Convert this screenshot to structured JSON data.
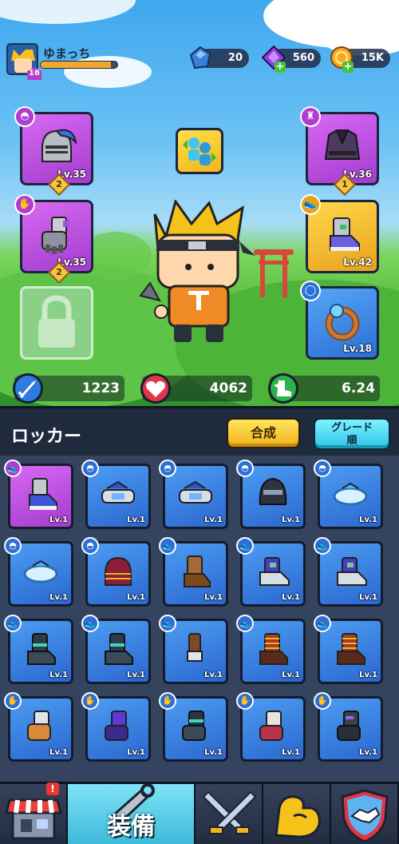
{
  "player": {
    "name": "ゆまっち",
    "level": "16",
    "xp_fraction": 0.92
  },
  "currencies": {
    "crystal": "20",
    "gem": "560",
    "coin": "15K"
  },
  "equipment": {
    "head": {
      "level": "Lv.35",
      "rank": "2"
    },
    "hands": {
      "level": "Lv.35",
      "rank": "2"
    },
    "body": {
      "level": "Lv.36",
      "rank": "1"
    },
    "feet": {
      "level": "Lv.42"
    },
    "ring": {
      "level": "Lv.18"
    }
  },
  "stats": {
    "attack": "1223",
    "health": "4062",
    "speed": "6.24"
  },
  "locker": {
    "title": "ロッカー",
    "merge_label": "合成",
    "sort_label_line1": "グレード",
    "sort_label_line2": "順",
    "items": [
      {
        "type": "shoe",
        "rarity": "purple",
        "art": "sneaker-gray",
        "level": "Lv.1"
      },
      {
        "type": "helmet",
        "rarity": "blue",
        "art": "headband-blue",
        "level": "Lv.1"
      },
      {
        "type": "helmet",
        "rarity": "blue",
        "art": "headband-blue",
        "level": "Lv.1"
      },
      {
        "type": "helmet",
        "rarity": "blue",
        "art": "ninja-hood",
        "level": "Lv.1"
      },
      {
        "type": "helmet",
        "rarity": "blue",
        "art": "headband-cyan",
        "level": "Lv.1"
      },
      {
        "type": "helmet",
        "rarity": "blue",
        "art": "headband-cyan",
        "level": "Lv.1"
      },
      {
        "type": "helmet",
        "rarity": "blue",
        "art": "samurai-helmet",
        "level": "Lv.1"
      },
      {
        "type": "shoe",
        "rarity": "blue",
        "art": "brown-boot",
        "level": "Lv.1"
      },
      {
        "type": "shoe",
        "rarity": "blue",
        "art": "purple-sneaker",
        "level": "Lv.1"
      },
      {
        "type": "shoe",
        "rarity": "blue",
        "art": "purple-sneaker",
        "level": "Lv.1"
      },
      {
        "type": "shoe",
        "rarity": "blue",
        "art": "teal-boot",
        "level": "Lv.1"
      },
      {
        "type": "shoe",
        "rarity": "blue",
        "art": "teal-boot",
        "level": "Lv.1"
      },
      {
        "type": "shoe",
        "rarity": "blue",
        "art": "wrapped-boot",
        "level": "Lv.1"
      },
      {
        "type": "shoe",
        "rarity": "blue",
        "art": "striped-boot",
        "level": "Lv.1"
      },
      {
        "type": "shoe",
        "rarity": "blue",
        "art": "striped-boot",
        "level": "Lv.1"
      },
      {
        "type": "glove",
        "rarity": "blue",
        "art": "bandaged-glove",
        "level": "Lv.1"
      },
      {
        "type": "glove",
        "rarity": "blue",
        "art": "purple-glove",
        "level": "Lv.1"
      },
      {
        "type": "glove",
        "rarity": "blue",
        "art": "teal-glove",
        "level": "Lv.1"
      },
      {
        "type": "glove",
        "rarity": "blue",
        "art": "wrapped-glove",
        "level": "Lv.1"
      },
      {
        "type": "glove",
        "rarity": "blue",
        "art": "dark-glove",
        "level": "Lv.1"
      }
    ]
  },
  "nav": {
    "shop_alert": "!",
    "equip_label": "装備"
  },
  "colors": {
    "accent_yellow": "#f1b21a",
    "accent_cyan": "#2ec5e6",
    "rarity_blue": "#2b67cf",
    "rarity_purple": "#a33ccf"
  }
}
